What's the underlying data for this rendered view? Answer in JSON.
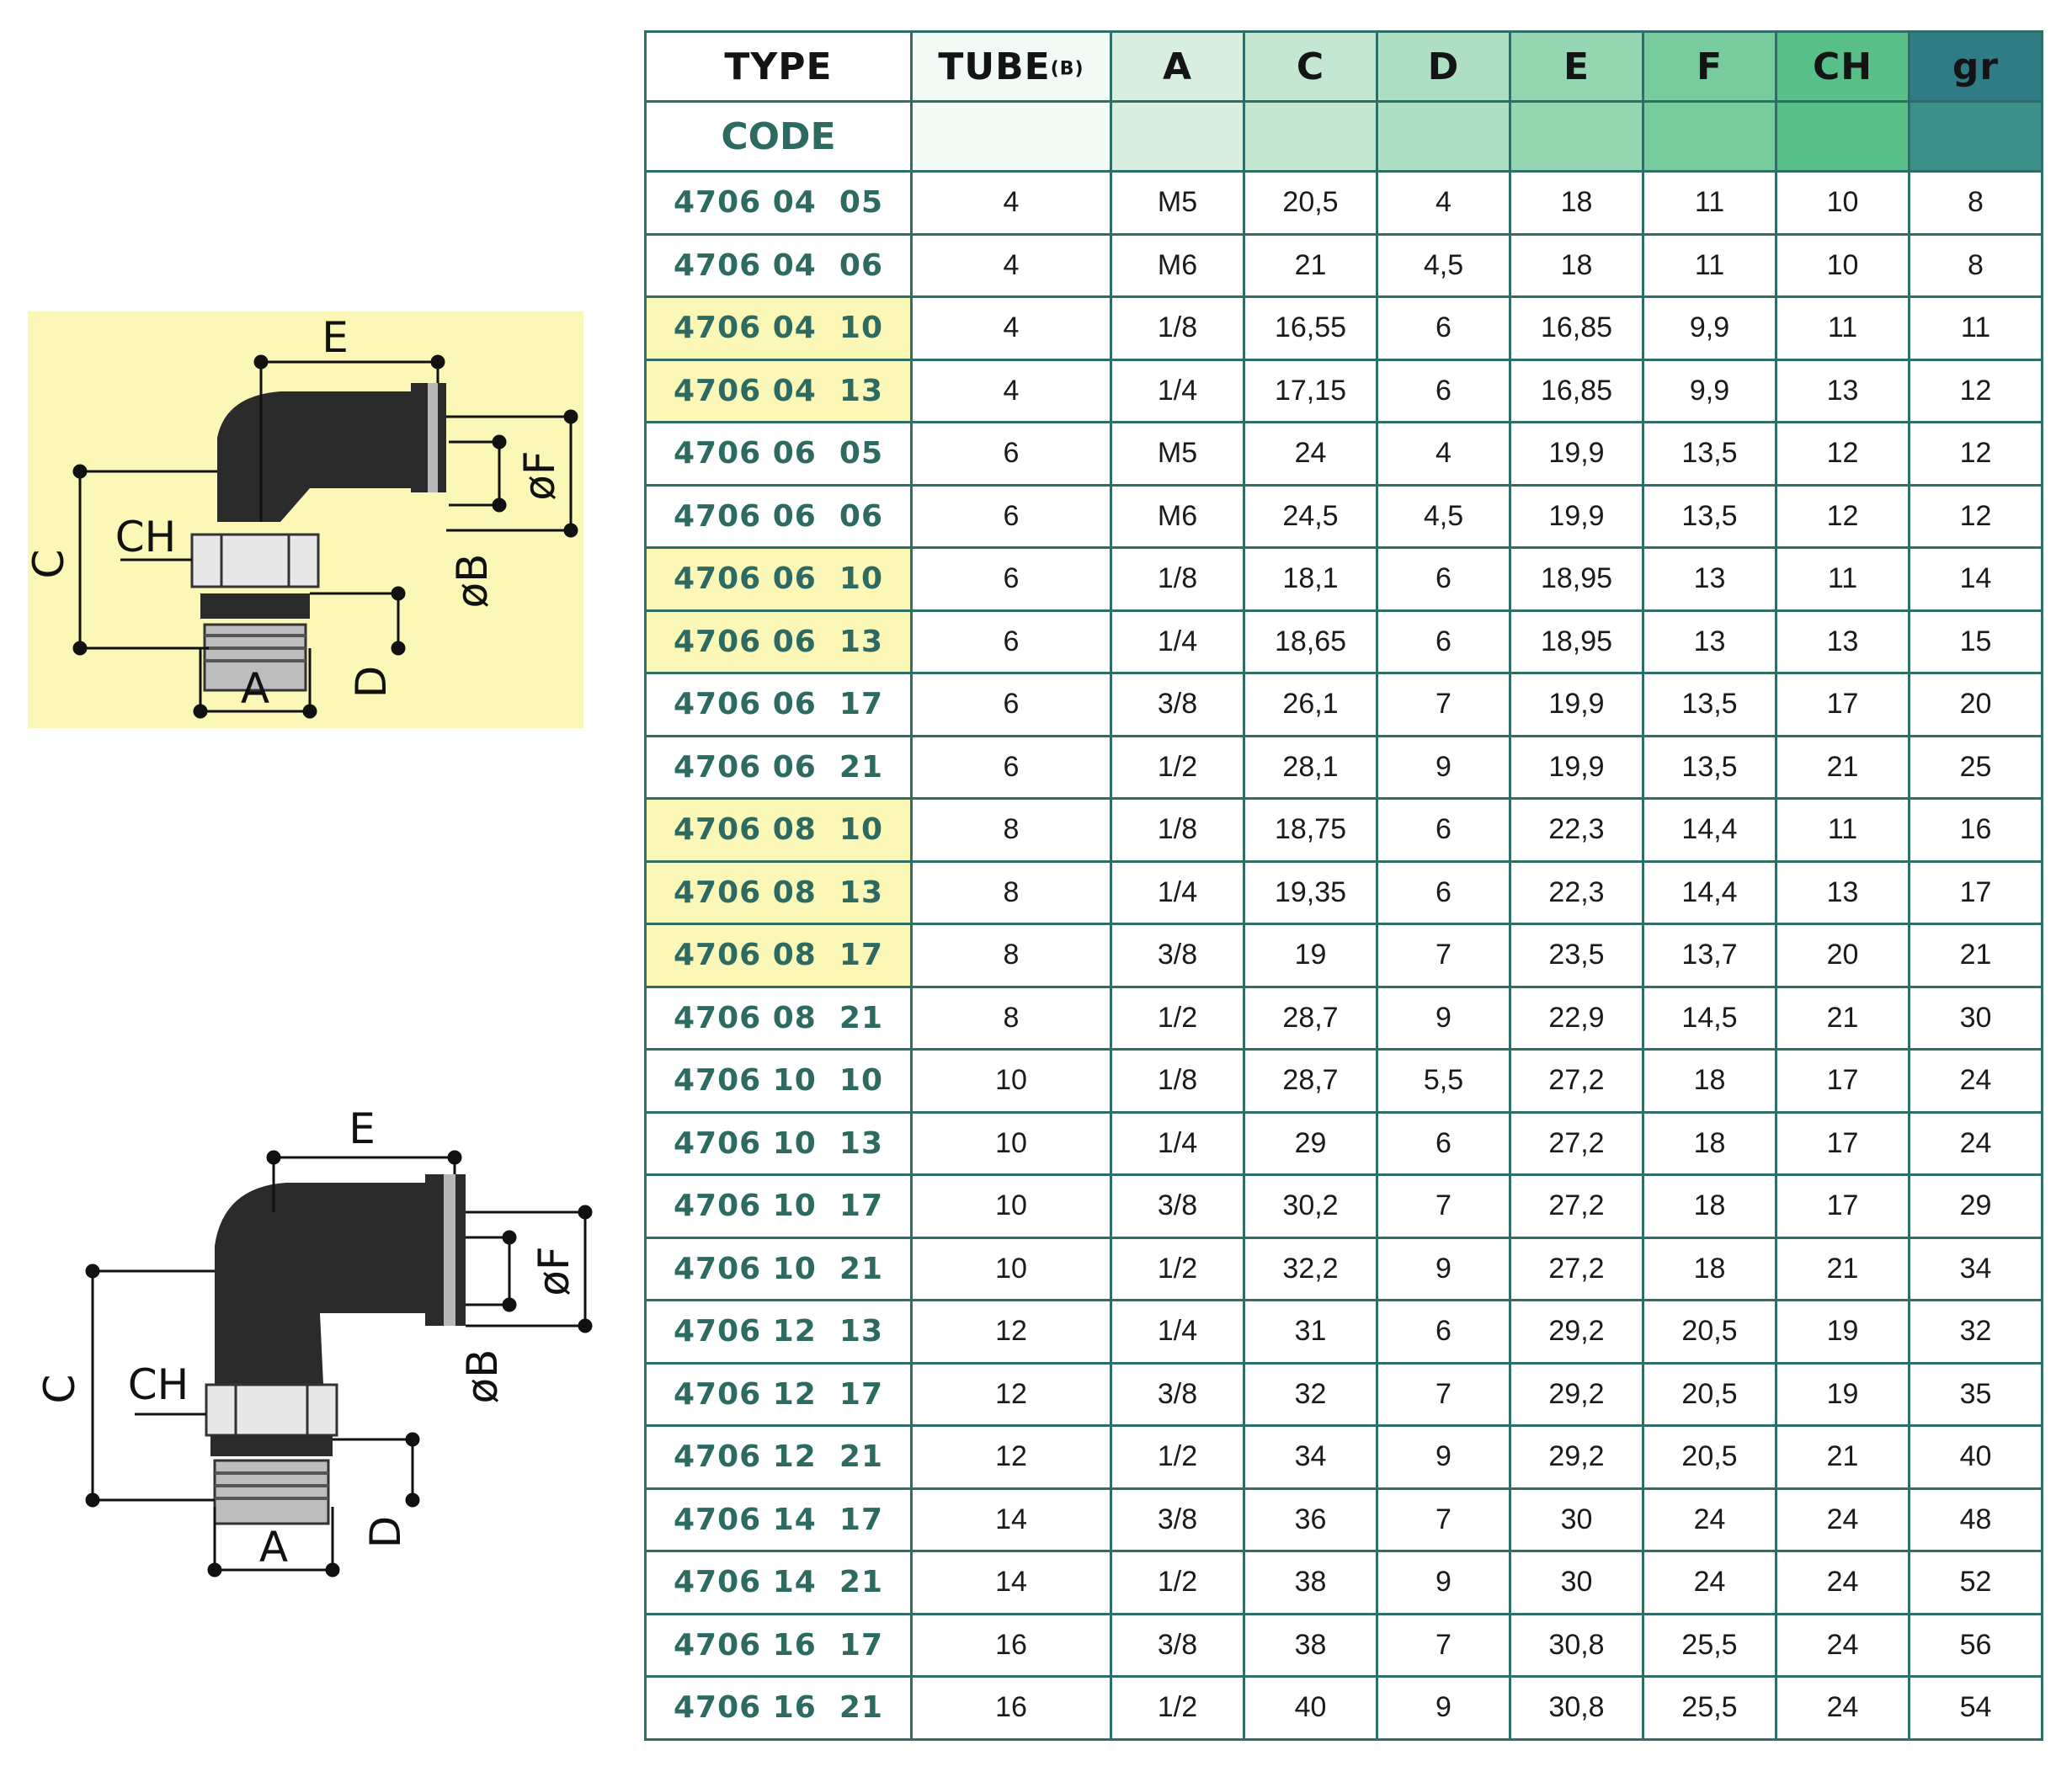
{
  "header": {
    "type": "TYPE",
    "tube": "TUBE",
    "tube_sub": "(B)",
    "a": "A",
    "c": "C",
    "d": "D",
    "e": "E",
    "f": "F",
    "ch": "CH",
    "gr": "gr",
    "code": "CODE"
  },
  "drawing_labels": {
    "e": "E",
    "c": "C",
    "ch": "CH",
    "a": "A",
    "d": "D",
    "b": "øB",
    "f": "øF"
  },
  "colors": {
    "highlight": "#fbf7b6",
    "code_text": "#2d6b62",
    "grid": "#2f6e66"
  },
  "rows": [
    {
      "code": "4706 04  05",
      "highlight": false,
      "tube": "4",
      "a": "M5",
      "c": "20,5",
      "d": "4",
      "e": "18",
      "f": "11",
      "ch": "10",
      "gr": "8"
    },
    {
      "code": "4706 04  06",
      "highlight": false,
      "tube": "4",
      "a": "M6",
      "c": "21",
      "d": "4,5",
      "e": "18",
      "f": "11",
      "ch": "10",
      "gr": "8"
    },
    {
      "code": "4706 04  10",
      "highlight": true,
      "tube": "4",
      "a": "1/8",
      "c": "16,55",
      "d": "6",
      "e": "16,85",
      "f": "9,9",
      "ch": "11",
      "gr": "11"
    },
    {
      "code": "4706 04  13",
      "highlight": true,
      "tube": "4",
      "a": "1/4",
      "c": "17,15",
      "d": "6",
      "e": "16,85",
      "f": "9,9",
      "ch": "13",
      "gr": "12"
    },
    {
      "code": "4706 06  05",
      "highlight": false,
      "tube": "6",
      "a": "M5",
      "c": "24",
      "d": "4",
      "e": "19,9",
      "f": "13,5",
      "ch": "12",
      "gr": "12"
    },
    {
      "code": "4706 06  06",
      "highlight": false,
      "tube": "6",
      "a": "M6",
      "c": "24,5",
      "d": "4,5",
      "e": "19,9",
      "f": "13,5",
      "ch": "12",
      "gr": "12"
    },
    {
      "code": "4706 06  10",
      "highlight": true,
      "tube": "6",
      "a": "1/8",
      "c": "18,1",
      "d": "6",
      "e": "18,95",
      "f": "13",
      "ch": "11",
      "gr": "14"
    },
    {
      "code": "4706 06  13",
      "highlight": true,
      "tube": "6",
      "a": "1/4",
      "c": "18,65",
      "d": "6",
      "e": "18,95",
      "f": "13",
      "ch": "13",
      "gr": "15"
    },
    {
      "code": "4706 06  17",
      "highlight": false,
      "tube": "6",
      "a": "3/8",
      "c": "26,1",
      "d": "7",
      "e": "19,9",
      "f": "13,5",
      "ch": "17",
      "gr": "20"
    },
    {
      "code": "4706 06  21",
      "highlight": false,
      "tube": "6",
      "a": "1/2",
      "c": "28,1",
      "d": "9",
      "e": "19,9",
      "f": "13,5",
      "ch": "21",
      "gr": "25"
    },
    {
      "code": "4706 08  10",
      "highlight": true,
      "tube": "8",
      "a": "1/8",
      "c": "18,75",
      "d": "6",
      "e": "22,3",
      "f": "14,4",
      "ch": "11",
      "gr": "16"
    },
    {
      "code": "4706 08  13",
      "highlight": true,
      "tube": "8",
      "a": "1/4",
      "c": "19,35",
      "d": "6",
      "e": "22,3",
      "f": "14,4",
      "ch": "13",
      "gr": "17"
    },
    {
      "code": "4706 08  17",
      "highlight": true,
      "tube": "8",
      "a": "3/8",
      "c": "19",
      "d": "7",
      "e": "23,5",
      "f": "13,7",
      "ch": "20",
      "gr": "21"
    },
    {
      "code": "4706 08  21",
      "highlight": false,
      "tube": "8",
      "a": "1/2",
      "c": "28,7",
      "d": "9",
      "e": "22,9",
      "f": "14,5",
      "ch": "21",
      "gr": "30"
    },
    {
      "code": "4706 10  10",
      "highlight": false,
      "tube": "10",
      "a": "1/8",
      "c": "28,7",
      "d": "5,5",
      "e": "27,2",
      "f": "18",
      "ch": "17",
      "gr": "24"
    },
    {
      "code": "4706 10  13",
      "highlight": false,
      "tube": "10",
      "a": "1/4",
      "c": "29",
      "d": "6",
      "e": "27,2",
      "f": "18",
      "ch": "17",
      "gr": "24"
    },
    {
      "code": "4706 10  17",
      "highlight": false,
      "tube": "10",
      "a": "3/8",
      "c": "30,2",
      "d": "7",
      "e": "27,2",
      "f": "18",
      "ch": "17",
      "gr": "29"
    },
    {
      "code": "4706 10  21",
      "highlight": false,
      "tube": "10",
      "a": "1/2",
      "c": "32,2",
      "d": "9",
      "e": "27,2",
      "f": "18",
      "ch": "21",
      "gr": "34"
    },
    {
      "code": "4706 12  13",
      "highlight": false,
      "tube": "12",
      "a": "1/4",
      "c": "31",
      "d": "6",
      "e": "29,2",
      "f": "20,5",
      "ch": "19",
      "gr": "32"
    },
    {
      "code": "4706 12  17",
      "highlight": false,
      "tube": "12",
      "a": "3/8",
      "c": "32",
      "d": "7",
      "e": "29,2",
      "f": "20,5",
      "ch": "19",
      "gr": "35"
    },
    {
      "code": "4706 12  21",
      "highlight": false,
      "tube": "12",
      "a": "1/2",
      "c": "34",
      "d": "9",
      "e": "29,2",
      "f": "20,5",
      "ch": "21",
      "gr": "40"
    },
    {
      "code": "4706 14  17",
      "highlight": false,
      "tube": "14",
      "a": "3/8",
      "c": "36",
      "d": "7",
      "e": "30",
      "f": "24",
      "ch": "24",
      "gr": "48"
    },
    {
      "code": "4706 14  21",
      "highlight": false,
      "tube": "14",
      "a": "1/2",
      "c": "38",
      "d": "9",
      "e": "30",
      "f": "24",
      "ch": "24",
      "gr": "52"
    },
    {
      "code": "4706 16  17",
      "highlight": false,
      "tube": "16",
      "a": "3/8",
      "c": "38",
      "d": "7",
      "e": "30,8",
      "f": "25,5",
      "ch": "24",
      "gr": "56"
    },
    {
      "code": "4706 16  21",
      "highlight": false,
      "tube": "16",
      "a": "1/2",
      "c": "40",
      "d": "9",
      "e": "30,8",
      "f": "25,5",
      "ch": "24",
      "gr": "54"
    }
  ]
}
